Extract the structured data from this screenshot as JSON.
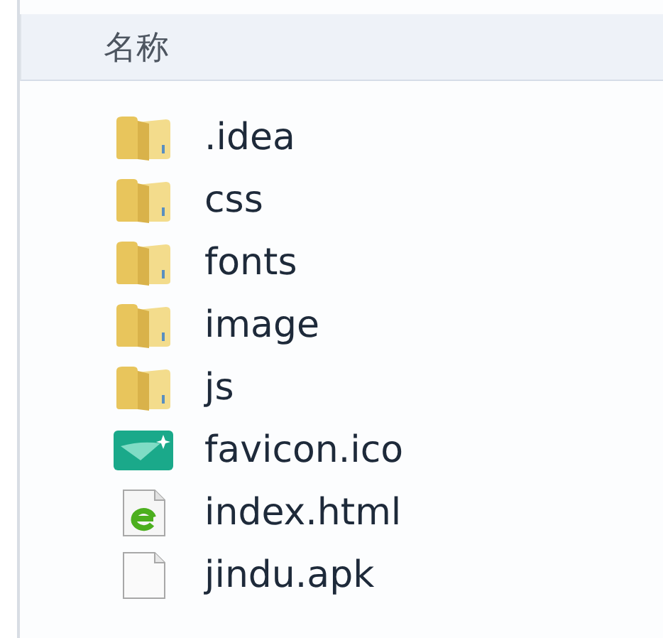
{
  "header": {
    "column": "名称"
  },
  "files": [
    {
      "name": ".idea",
      "kind": "folder"
    },
    {
      "name": "css",
      "kind": "folder"
    },
    {
      "name": "fonts",
      "kind": "folder"
    },
    {
      "name": "image",
      "kind": "folder"
    },
    {
      "name": "js",
      "kind": "folder"
    },
    {
      "name": "favicon.ico",
      "kind": "favicon"
    },
    {
      "name": "index.html",
      "kind": "html"
    },
    {
      "name": "jindu.apk",
      "kind": "file"
    }
  ]
}
